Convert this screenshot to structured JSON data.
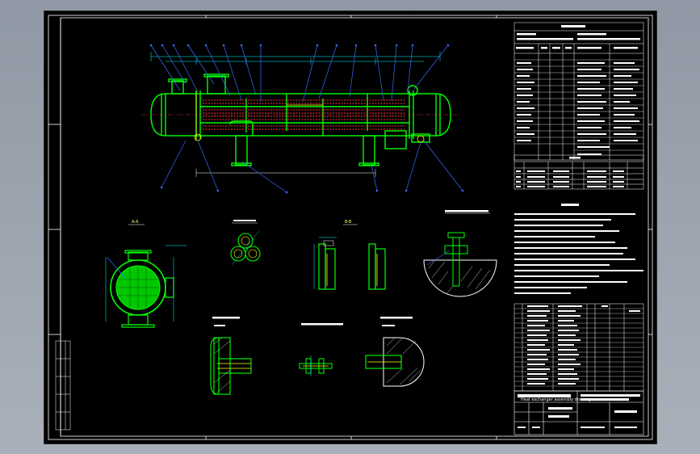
{
  "viewer": {
    "background_color": "#9aa2ad",
    "sheet_color": "#000000"
  },
  "drawing": {
    "frame_color": "#ffffff",
    "body_color": "#00ff00",
    "hidden_color": "#ff3b3b",
    "dimension_color": "#00ffff",
    "leader_color": "#3b6bff",
    "text_color": "#ffffff",
    "accent_color": "#ffff00",
    "section_labels": [
      "A-A",
      "B-B"
    ],
    "title_block_note": "Heat exchanger assembly drawing"
  }
}
